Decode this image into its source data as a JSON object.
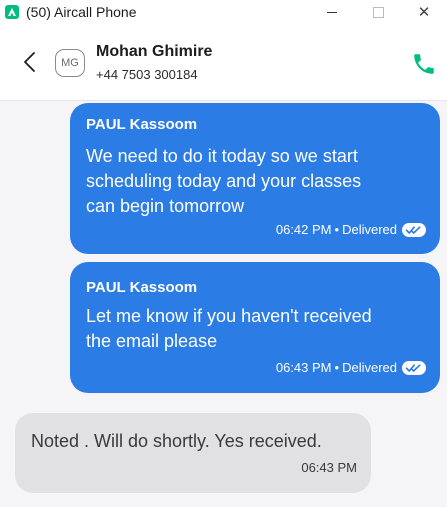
{
  "window": {
    "title": "(50) Aircall Phone",
    "close_glyph": "✕"
  },
  "contact": {
    "initials": "MG",
    "name": "Mohan Ghimire",
    "phone": "+44 7503 300184"
  },
  "messages": [
    {
      "direction": "outgoing",
      "sender": "PAUL Kassoom",
      "lines": [
        "We need to do it today so we start",
        "scheduling today and your classes",
        "can begin tomorrow"
      ],
      "time": "06:42 PM",
      "status": "Delivered"
    },
    {
      "direction": "outgoing",
      "sender": "PAUL Kassoom",
      "lines": [
        "Let me know if you haven't received",
        "the email please"
      ],
      "time": "06:43 PM",
      "status": "Delivered"
    },
    {
      "direction": "incoming",
      "lines": [
        "Noted . Will do shortly. Yes received."
      ],
      "time": "06:43 PM"
    }
  ],
  "meta_separator": "•",
  "colors": {
    "brand_green": "#00bd82",
    "outgoing_bubble": "#2b7ce4",
    "incoming_bubble": "#e1e1e3"
  },
  "icons": {
    "app": "aircall-logo-icon",
    "back": "chevron-left-icon",
    "call": "phone-icon",
    "delivered": "double-check-icon"
  }
}
